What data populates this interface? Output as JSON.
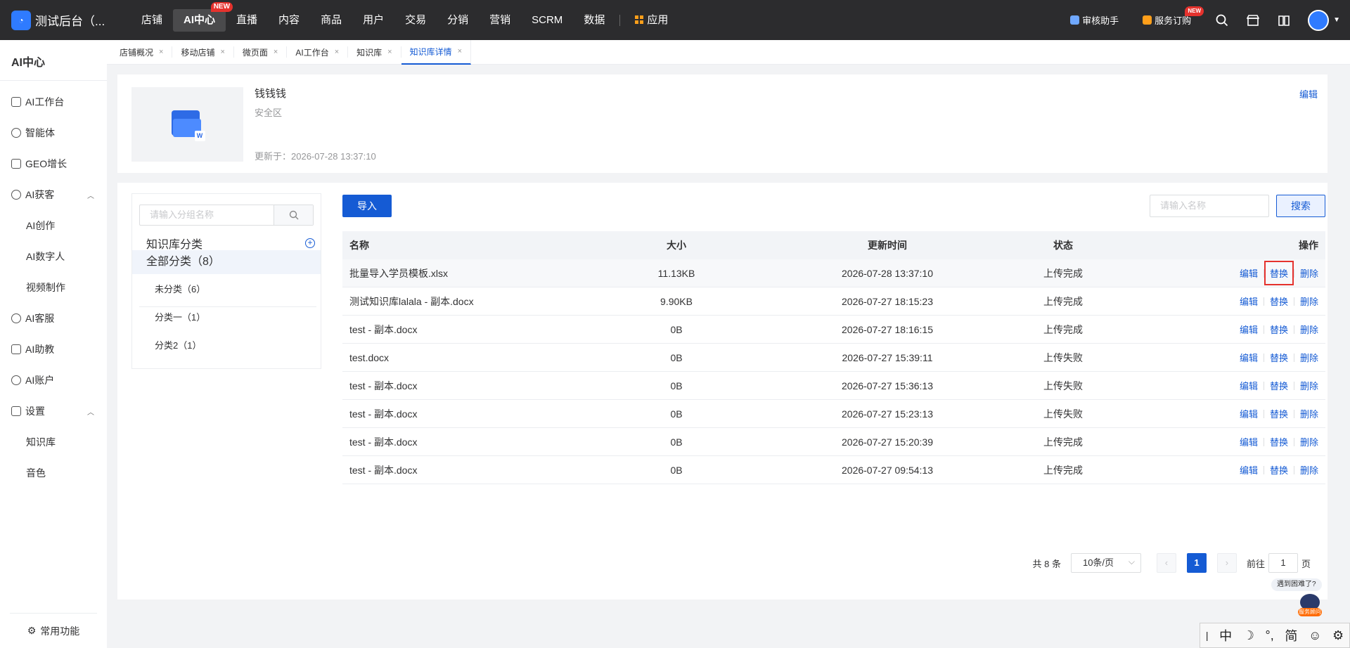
{
  "topbar": {
    "brand": "测试后台（...",
    "nav": [
      {
        "label": "店铺"
      },
      {
        "label": "AI中心",
        "badge": "NEW"
      },
      {
        "label": "直播"
      },
      {
        "label": "内容"
      },
      {
        "label": "商品"
      },
      {
        "label": "用户"
      },
      {
        "label": "交易"
      },
      {
        "label": "分销"
      },
      {
        "label": "营销"
      },
      {
        "label": "SCRM"
      },
      {
        "label": "数据"
      }
    ],
    "apps_label": "应用",
    "review_assistant": "审核助手",
    "service_subscribe": "服务订购",
    "service_badge": "NEW"
  },
  "sidebar": {
    "title": "AI中心",
    "items": [
      {
        "label": "AI工作台"
      },
      {
        "label": "智能体"
      },
      {
        "label": "GEO增长"
      },
      {
        "label": "AI获客"
      },
      {
        "label": "AI创作"
      },
      {
        "label": "AI数字人"
      },
      {
        "label": "视频制作"
      },
      {
        "label": "AI客服"
      },
      {
        "label": "AI助教"
      },
      {
        "label": "AI账户"
      },
      {
        "label": "设置"
      },
      {
        "label": "知识库"
      },
      {
        "label": "音色"
      }
    ],
    "bottom": "常用功能"
  },
  "tabs": [
    {
      "label": "店铺概况"
    },
    {
      "label": "移动店铺"
    },
    {
      "label": "微页面"
    },
    {
      "label": "AI工作台"
    },
    {
      "label": "知识库"
    },
    {
      "label": "知识库详情"
    }
  ],
  "kb": {
    "name": "钱钱钱",
    "zone": "安全区",
    "updated": "更新于：2026-07-28 13:37:10",
    "edit": "编辑"
  },
  "groups": {
    "search_placeholder": "请输入分组名称",
    "title": "知识库分类",
    "all": "全部分类（8）",
    "items": [
      {
        "label": "未分类（6）"
      },
      {
        "label": "分类一（1）"
      },
      {
        "label": "分类2（1）"
      }
    ]
  },
  "toolbar": {
    "import": "导入",
    "search_placeholder": "请输入名称",
    "search": "搜索"
  },
  "table": {
    "headers": {
      "name": "名称",
      "size": "大小",
      "time": "更新时间",
      "status": "状态",
      "ops": "操作"
    },
    "ops": {
      "edit": "编辑",
      "replace": "替换",
      "delete": "删除"
    },
    "rows": [
      {
        "name": "批量导入学员模板.xlsx",
        "size": "11.13KB",
        "time": "2026-07-28 13:37:10",
        "status": "上传完成"
      },
      {
        "name": "测试知识库lalala - 副本.docx",
        "size": "9.90KB",
        "time": "2026-07-27 18:15:23",
        "status": "上传完成"
      },
      {
        "name": "test - 副本.docx",
        "size": "0B",
        "time": "2026-07-27 18:16:15",
        "status": "上传完成"
      },
      {
        "name": "test.docx",
        "size": "0B",
        "time": "2026-07-27 15:39:11",
        "status": "上传失败"
      },
      {
        "name": "test - 副本.docx",
        "size": "0B",
        "time": "2026-07-27 15:36:13",
        "status": "上传失败"
      },
      {
        "name": "test - 副本.docx",
        "size": "0B",
        "time": "2026-07-27 15:23:13",
        "status": "上传失败"
      },
      {
        "name": "test - 副本.docx",
        "size": "0B",
        "time": "2026-07-27 15:20:39",
        "status": "上传完成"
      },
      {
        "name": "test - 副本.docx",
        "size": "0B",
        "time": "2026-07-27 09:54:13",
        "status": "上传完成"
      }
    ]
  },
  "pager": {
    "total": "共 8 条",
    "page_size": "10条/页",
    "current": "1",
    "goto_prefix": "前往",
    "goto_value": "1",
    "goto_suffix": "页"
  },
  "help": {
    "bubble": "遇到困难了?",
    "bot_label": "服务顾问"
  },
  "ime": {
    "mode": "中",
    "simplified": "简"
  },
  "colors": {
    "primary": "#155bd4",
    "topbar": "#2c2c2e",
    "badge": "#e5322d",
    "highlight_box": "#e5322d"
  }
}
